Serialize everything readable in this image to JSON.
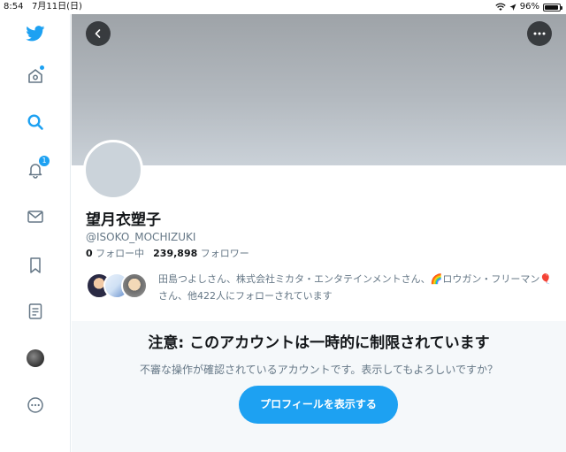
{
  "status_bar": {
    "time": "8:54",
    "date": "7月11日(日)",
    "battery": "96%",
    "battery_level": 0.96
  },
  "sidebar": {
    "items": [
      {
        "name": "twitter-logo",
        "icon": "twitter-bird-icon"
      },
      {
        "name": "home",
        "icon": "home-icon",
        "has_dot": true
      },
      {
        "name": "explore",
        "icon": "search-icon"
      },
      {
        "name": "notifications",
        "icon": "bell-icon",
        "badge": "1"
      },
      {
        "name": "messages",
        "icon": "mail-icon"
      },
      {
        "name": "bookmarks",
        "icon": "bookmark-icon"
      },
      {
        "name": "lists",
        "icon": "list-icon"
      },
      {
        "name": "profile",
        "icon": "avatar"
      },
      {
        "name": "more",
        "icon": "more-circle-icon"
      }
    ]
  },
  "header": {
    "back_icon": "chevron-left-icon",
    "more_icon": "ellipsis-icon"
  },
  "profile": {
    "display_name": "望月衣塑子",
    "handle": "@ISOKO_MOCHIZUKI",
    "following_count": "0",
    "following_label": "フォロー中",
    "followers_count": "239,898",
    "followers_label": "フォロワー",
    "followed_by": "田島つよしさん、株式会社ミカタ・エンタテインメントさん、🌈ロウガン・フリーマン🎈 さん、他422人にフォローされています"
  },
  "notice": {
    "title": "注意: このアカウントは一時的に制限されています",
    "description": "不審な操作が確認されているアカウントです。表示してもよろしいですか？",
    "button_label": "プロフィールを表示する"
  },
  "colors": {
    "accent": "#1da1f2",
    "text_primary": "#14171a",
    "text_secondary": "#657786",
    "notice_bg": "#f5f8fa"
  }
}
